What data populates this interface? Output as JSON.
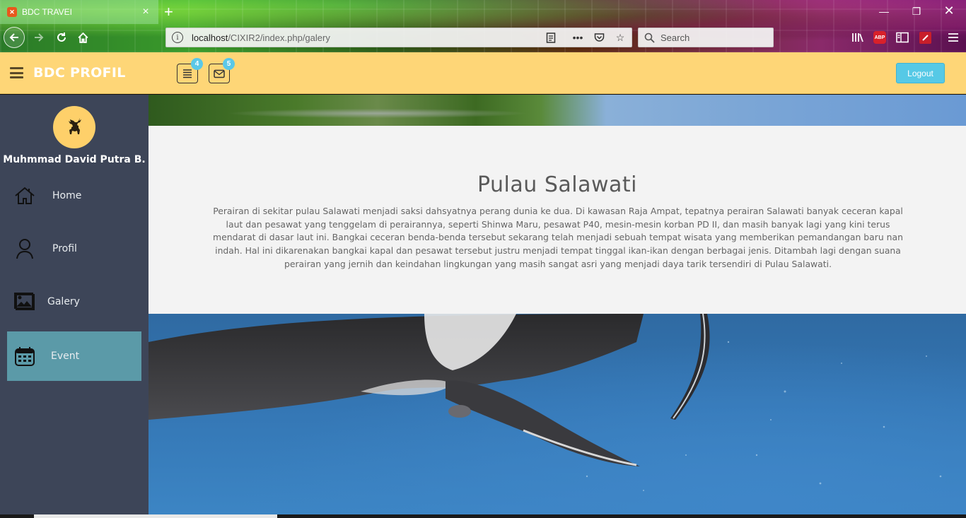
{
  "browser": {
    "tab_title": "BDC TRAVEI",
    "url_host": "localhost",
    "url_path": "/CIXIR2/index.php/galery",
    "search_placeholder": "Search",
    "abp_label": "ABP"
  },
  "header": {
    "brand": "BDC PROFIL",
    "tasks_badge": "4",
    "messages_badge": "5",
    "logout_label": "Logout"
  },
  "sidebar": {
    "user_name": "Muhmmad David Putra B.",
    "items": [
      {
        "label": "Home",
        "icon": "home-icon"
      },
      {
        "label": "Profil",
        "icon": "user-icon"
      },
      {
        "label": "Galery",
        "icon": "image-icon"
      },
      {
        "label": "Event",
        "icon": "calendar-icon",
        "active": true
      }
    ]
  },
  "content": {
    "title": "Pulau Salawati",
    "body": "Perairan di sekitar pulau Salawati menjadi saksi dahsyatnya perang dunia ke dua. Di kawasan Raja Ampat, tepatnya perairan Salawati banyak ceceran kapal laut dan pesawat yang tenggelam di perairannya, seperti Shinwa Maru, pesawat P40, mesin-mesin korban PD II, dan masih banyak lagi yang kini terus mendarat di dasar laut ini. Bangkai ceceran benda-benda tersebut sekarang telah menjadi sebuah tempat wisata yang memberikan pemandangan baru nan indah. Hal ini dikarenakan bangkai kapal dan pesawat tersebut justru menjadi tempat tinggal ikan-ikan dengan berbagai jenis. Ditambah lagi dengan suana perairan yang jernih dan keindahan lingkungan yang masih sangat asri yang menjadi daya tarik tersendiri di Pulau Salawati."
  },
  "colors": {
    "header_bg": "#fed677",
    "sidebar_bg": "#3d4558",
    "active_item": "#5b9aa8",
    "logout_btn": "#56c9e6",
    "badge": "#5bc8e8"
  }
}
